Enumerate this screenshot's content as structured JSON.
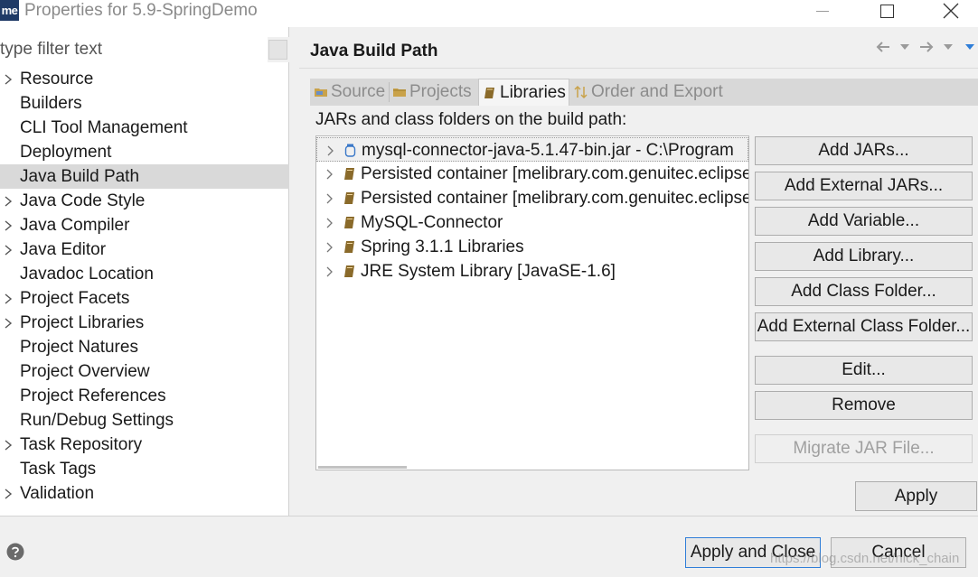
{
  "window": {
    "app_icon_text": "me",
    "title": "Properties for 5.9-SpringDemo",
    "icons": [
      "minimize-icon",
      "maximize-icon",
      "close-icon"
    ]
  },
  "sidebar": {
    "filter_placeholder": "type filter text",
    "items": [
      {
        "label": "Resource",
        "expandable": true,
        "selected": false
      },
      {
        "label": "Builders",
        "expandable": false,
        "selected": false
      },
      {
        "label": "CLI Tool Management",
        "expandable": false,
        "selected": false
      },
      {
        "label": "Deployment",
        "expandable": false,
        "selected": false
      },
      {
        "label": "Java Build Path",
        "expandable": false,
        "selected": true
      },
      {
        "label": "Java Code Style",
        "expandable": true,
        "selected": false
      },
      {
        "label": "Java Compiler",
        "expandable": true,
        "selected": false
      },
      {
        "label": "Java Editor",
        "expandable": true,
        "selected": false
      },
      {
        "label": "Javadoc Location",
        "expandable": false,
        "selected": false
      },
      {
        "label": "Project Facets",
        "expandable": true,
        "selected": false
      },
      {
        "label": "Project Libraries",
        "expandable": true,
        "selected": false
      },
      {
        "label": "Project Natures",
        "expandable": false,
        "selected": false
      },
      {
        "label": "Project Overview",
        "expandable": false,
        "selected": false
      },
      {
        "label": "Project References",
        "expandable": false,
        "selected": false
      },
      {
        "label": "Run/Debug Settings",
        "expandable": false,
        "selected": false
      },
      {
        "label": "Task Repository",
        "expandable": true,
        "selected": false
      },
      {
        "label": "Task Tags",
        "expandable": false,
        "selected": false
      },
      {
        "label": "Validation",
        "expandable": true,
        "selected": false
      }
    ]
  },
  "panel": {
    "title": "Java Build Path",
    "nav_icons": [
      "back-icon",
      "back-menu-icon",
      "forward-icon",
      "forward-menu-icon",
      "view-menu-icon"
    ],
    "tabs": [
      {
        "label": "Source",
        "icon": "source-folder-icon",
        "active": false
      },
      {
        "label": "Projects",
        "icon": "projects-icon",
        "active": false
      },
      {
        "label": "Libraries",
        "icon": "library-icon",
        "active": true
      },
      {
        "label": "Order and Export",
        "icon": "order-export-icon",
        "active": false
      }
    ],
    "section_label": "JARs and class folders on the build path:",
    "libraries": [
      {
        "label": "mysql-connector-java-5.1.47-bin.jar - C:\\Program",
        "icon": "jar-icon"
      },
      {
        "label": "Persisted container [melibrary.com.genuitec.eclipse",
        "icon": "library-icon"
      },
      {
        "label": "Persisted container [melibrary.com.genuitec.eclipse",
        "icon": "library-icon"
      },
      {
        "label": "MySQL-Connector",
        "icon": "library-icon"
      },
      {
        "label": "Spring 3.1.1 Libraries",
        "icon": "library-icon"
      },
      {
        "label": "JRE System Library [JavaSE-1.6]",
        "icon": "library-icon"
      }
    ],
    "buttons": {
      "add_jars": "Add JARs...",
      "add_external_jars": "Add External JARs...",
      "add_variable": "Add Variable...",
      "add_library": "Add Library...",
      "add_class_folder": "Add Class Folder...",
      "add_external_class_folder": "Add External Class Folder...",
      "edit": "Edit...",
      "remove": "Remove",
      "migrate_jar": "Migrate JAR File...",
      "apply": "Apply"
    }
  },
  "footer": {
    "help_icon": "help-icon",
    "apply_and_close": "Apply and Close",
    "cancel": "Cancel",
    "watermark": "https://blog.csdn.net/nick_chain"
  },
  "colors": {
    "selection": "#d9d9d9",
    "default_button_border": "#2f7ed8",
    "app_icon_bg": "#1f3a66",
    "library_icon": "#8a6a2a",
    "jar_icon": "#3a78c8"
  }
}
